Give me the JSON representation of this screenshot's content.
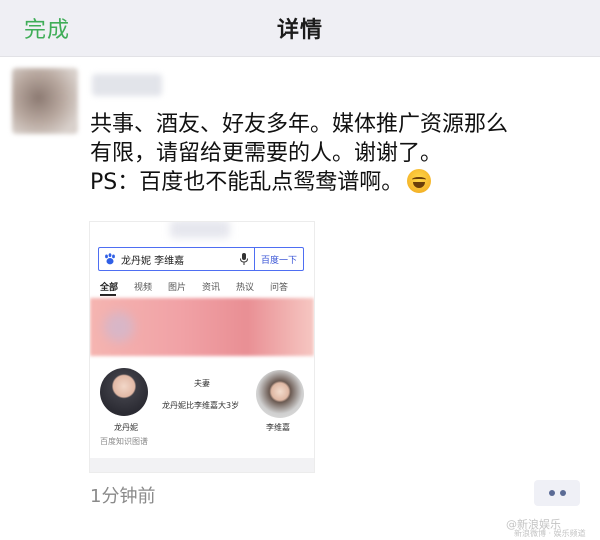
{
  "navbar": {
    "done_label": "完成",
    "title": "详情"
  },
  "post": {
    "lines": [
      "共事、酒友、好友多年。媒体推广资源那么",
      "有限，请留给更需要的人。谢谢了。",
      "PS：百度也不能乱点鸳鸯谱啊。"
    ],
    "emoji_icon": "laugh-cry-emoji-icon",
    "timestamp": "1分钟前"
  },
  "card": {
    "search_query": "龙丹妮 李维嘉",
    "search_button": "百度一下",
    "tabs": [
      "全部",
      "视频",
      "图片",
      "资讯",
      "热议",
      "问答"
    ],
    "relation_title": "夫妻",
    "relation_desc": "龙丹妮比李维嘉大3岁",
    "person_left_name": "龙丹妮",
    "person_left_source": "百度知识图谱",
    "person_right_name": "李维嘉"
  },
  "watermark": {
    "main": "@新浪娱乐",
    "sub": "新浪微博 · 娱乐频道"
  },
  "colors": {
    "accent_green": "#3fad57",
    "baidu_blue": "#4e6ef2",
    "nav_bg": "#efeff4"
  }
}
